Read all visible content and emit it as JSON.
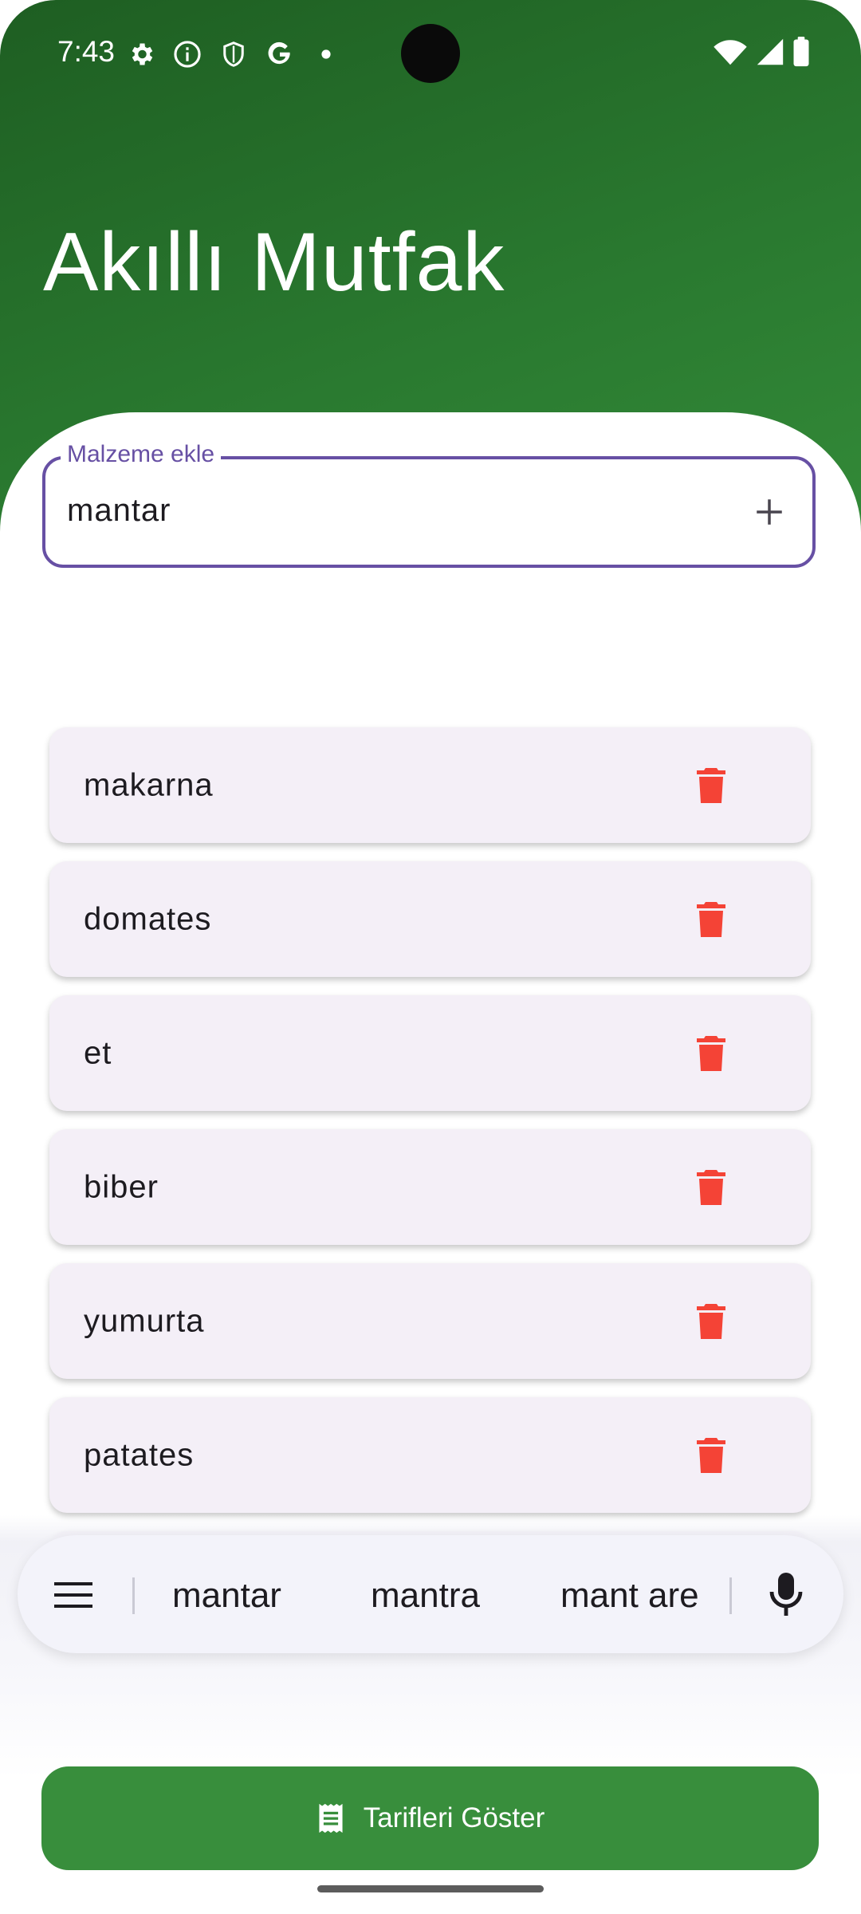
{
  "status_bar": {
    "time": "7:43",
    "left_icons": [
      "settings-icon",
      "info-icon",
      "shield-icon",
      "google-icon",
      "dot-icon"
    ],
    "right_icons": [
      "wifi-icon",
      "signal-icon",
      "battery-icon"
    ]
  },
  "header": {
    "title": "Akıllı Mutfak",
    "background_color": "#2a7a30"
  },
  "input": {
    "label": "Malzeme ekle",
    "value": "mantar",
    "accent_color": "#6750a4"
  },
  "ingredients": [
    {
      "name": "makarna"
    },
    {
      "name": "domates"
    },
    {
      "name": "et"
    },
    {
      "name": "biber"
    },
    {
      "name": "yumurta"
    },
    {
      "name": "patates"
    }
  ],
  "keyboard_suggestions": [
    "mantar",
    "mantra",
    "mant are"
  ],
  "cta": {
    "label": "Tarifleri Göster",
    "color": "#388e3c"
  },
  "delete_color": "#f44336"
}
